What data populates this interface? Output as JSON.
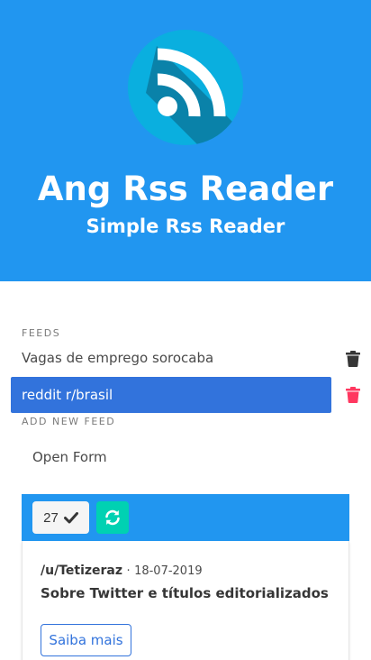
{
  "hero": {
    "title": "Ang Rss Reader",
    "subtitle": "Simple Rss Reader",
    "background": "#2196f0"
  },
  "feeds": {
    "label": "FEEDS",
    "items": [
      {
        "name": "Vagas de emprego sorocaba",
        "active": false,
        "delete_icon": "trash-icon",
        "delete_color": "#363636"
      },
      {
        "name": "reddit r/brasil",
        "active": true,
        "delete_icon": "trash-icon",
        "delete_color": "#ff3860"
      }
    ]
  },
  "add_feed": {
    "label": "ADD NEW FEED",
    "open_form_label": "Open Form"
  },
  "toolbar": {
    "count": "27",
    "count_icon": "check-icon",
    "refresh_icon": "refresh-icon",
    "refresh_color": "#00d1b2"
  },
  "post": {
    "author": "/u/Tetizeraz",
    "separator": "·",
    "date": "18-07-2019",
    "title": "Sobre Twitter e títulos editorializados",
    "read_more_label": "Saiba mais"
  },
  "colors": {
    "accent": "#2196f0",
    "link": "#3273dc",
    "danger": "#ff3860",
    "success": "#00d1b2"
  }
}
